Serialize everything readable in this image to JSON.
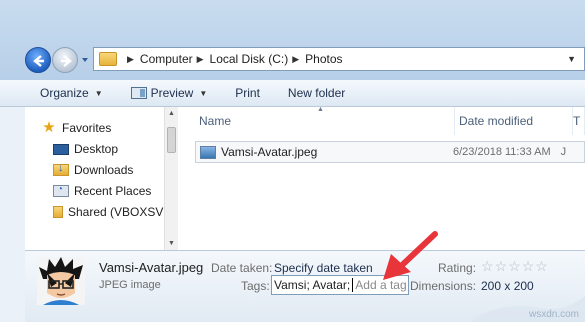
{
  "address_bar": {
    "crumbs": [
      "Computer",
      "Local Disk (C:)",
      "Photos"
    ]
  },
  "toolbar": {
    "organize_label": "Organize",
    "preview_label": "Preview",
    "print_label": "Print",
    "new_folder_label": "New folder"
  },
  "nav_pane": {
    "favorites_label": "Favorites",
    "items": [
      {
        "label": "Desktop",
        "icon": "desktop-icon"
      },
      {
        "label": "Downloads",
        "icon": "downloads-folder-icon"
      },
      {
        "label": "Recent Places",
        "icon": "recent-places-icon"
      },
      {
        "label": "Shared (VBOXSVR",
        "icon": "shared-folder-icon"
      }
    ]
  },
  "file_list": {
    "columns": [
      "Name",
      "Date modified",
      "T"
    ],
    "rows": [
      {
        "name": "Vamsi-Avatar.jpeg",
        "date_modified": "6/23/2018 11:33 AM",
        "type": "J"
      }
    ]
  },
  "details_pane": {
    "file_name": "Vamsi-Avatar.jpeg",
    "file_type": "JPEG image",
    "date_taken_label": "Date taken:",
    "date_taken_value": "Specify date taken",
    "tags_label": "Tags:",
    "tags_value": "Vamsi; Avatar;",
    "tags_placeholder": "Add a tag",
    "rating_label": "Rating:",
    "rating_value": 0,
    "rating_max": 5,
    "dimensions_label": "Dimensions:",
    "dimensions_value": "200 x 200"
  },
  "watermark": "wsxdn.com",
  "colors": {
    "annotation_arrow": "#e8353a",
    "selection_border": "#c9d3dd"
  }
}
